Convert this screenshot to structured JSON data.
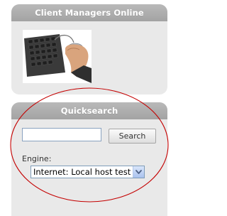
{
  "client_panel": {
    "title": "Client Managers Online",
    "image_alt": "hand-on-computer-mouse-and-keyboard"
  },
  "quicksearch": {
    "title": "Quicksearch",
    "search_value": "",
    "search_placeholder": "",
    "search_button_label": "Search",
    "engine_label": "Engine:",
    "engine_selected": "Internet: Local host test"
  },
  "colors": {
    "panel_bg": "#e9e9e9",
    "panel_header_bg": "#a9a9a9",
    "annotation_ellipse": "#c40000"
  },
  "icons": {
    "dropdown": "chevron-down-icon"
  }
}
